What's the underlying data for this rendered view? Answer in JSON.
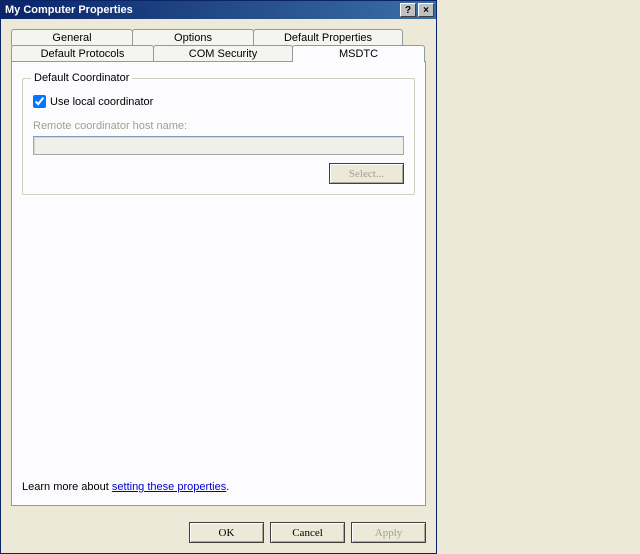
{
  "window": {
    "title": "My Computer Properties"
  },
  "tabs": {
    "row1": [
      {
        "label": "General"
      },
      {
        "label": "Options"
      },
      {
        "label": "Default Properties"
      }
    ],
    "row2": [
      {
        "label": "Default Protocols"
      },
      {
        "label": "COM Security"
      },
      {
        "label": "MSDTC"
      }
    ]
  },
  "groupbox": {
    "title": "Default Coordinator",
    "checkbox_label": "Use local coordinator",
    "remote_label": "Remote coordinator host name:",
    "select_button": "Select..."
  },
  "learn_more": {
    "prefix": "Learn more about ",
    "link": "setting these properties"
  },
  "buttons": {
    "ok": "OK",
    "cancel": "Cancel",
    "apply": "Apply"
  }
}
